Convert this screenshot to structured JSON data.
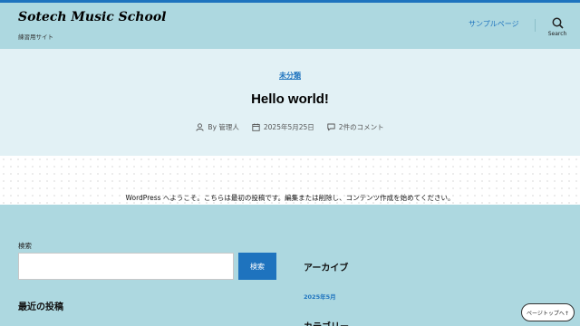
{
  "site": {
    "title": "Sotech Music School",
    "tagline": "練習用サイト"
  },
  "nav": {
    "link_label": "サンプルページ",
    "search_label": "Search"
  },
  "post": {
    "category": "未分類",
    "title": "Hello world!",
    "author": "By 管理人",
    "date": "2025年5月25日",
    "comments": "2件のコメント",
    "body": "WordPress へようこそ。こちらは最初の投稿です。編集または削除し、コンテンツ作成を始めてください。"
  },
  "widgets": {
    "search_label": "検索",
    "search_value": "",
    "search_button": "検索",
    "recent_posts_heading": "最近の投稿",
    "archive_heading": "アーカイブ",
    "archive_link": "2025年5月",
    "category_heading": "カテゴリー"
  },
  "back_to_top": "ページトップへ↑",
  "colors": {
    "accent": "#1e73be",
    "header_bg": "#add8e0",
    "post_header_bg": "#e2f1f5"
  }
}
